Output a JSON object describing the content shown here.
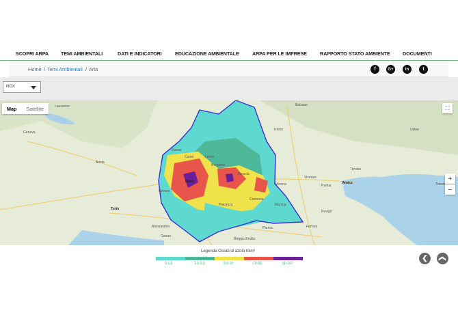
{
  "nav": {
    "items": [
      "SCOPRI ARPA",
      "TEMI AMBIENTALI",
      "DATI E INDICATORI",
      "EDUCAZIONE AMBIENTALE",
      "ARPA PER LE IMPRESE",
      "RAPPORTO STATO AMBIENTE",
      "DOCUMENTI"
    ]
  },
  "breadcrumb": {
    "home": "Home",
    "sep1": "/",
    "temi": "Temi Ambientali",
    "sep2": "/",
    "current": "Aria"
  },
  "social": {
    "facebook": {
      "icon": "facebook-icon",
      "glyph": "f"
    },
    "googleplus": {
      "icon": "google-plus-icon",
      "glyph": "G+"
    },
    "linkedin": {
      "icon": "linkedin-icon",
      "glyph": "in"
    },
    "twitter": {
      "icon": "twitter-icon",
      "glyph": "t"
    }
  },
  "selector": {
    "value": "NOX"
  },
  "map": {
    "map_type": {
      "map": "Map",
      "satellite": "Satellite"
    },
    "zoom_in": "+",
    "zoom_out": "−",
    "fullscreen_icon": "fullscreen-icon",
    "cities": [
      "Lausanne",
      "Geneva",
      "Milan",
      "Turin",
      "Bergamo",
      "Brescia",
      "Verona",
      "Padua",
      "Venice",
      "Trento",
      "Bolzano",
      "Genoa",
      "Parma",
      "Piacenza",
      "Cremona",
      "Mantua",
      "Ferrara",
      "Udine",
      "Trieste",
      "Reggio Emilia",
      "Alessandria",
      "Novara",
      "Varese",
      "Lecco",
      "Como",
      "Treviso",
      "Vicenza",
      "Rovigo",
      "Aosta"
    ]
  },
  "legend": {
    "title": "Legenda Ossidi di azoto t/km²",
    "classes": [
      {
        "label": "0-1.5",
        "color": "#5ed9d0"
      },
      {
        "label": "1.5-3.0",
        "color": "#4db89a"
      },
      {
        "label": "3.0-10",
        "color": "#f0e24a"
      },
      {
        "label": "10-50",
        "color": "#e8554a"
      },
      {
        "label": "50-197",
        "color": "#6a1f99"
      }
    ]
  },
  "footer": {
    "back_glyph": "❮",
    "top_glyph": "❯"
  }
}
